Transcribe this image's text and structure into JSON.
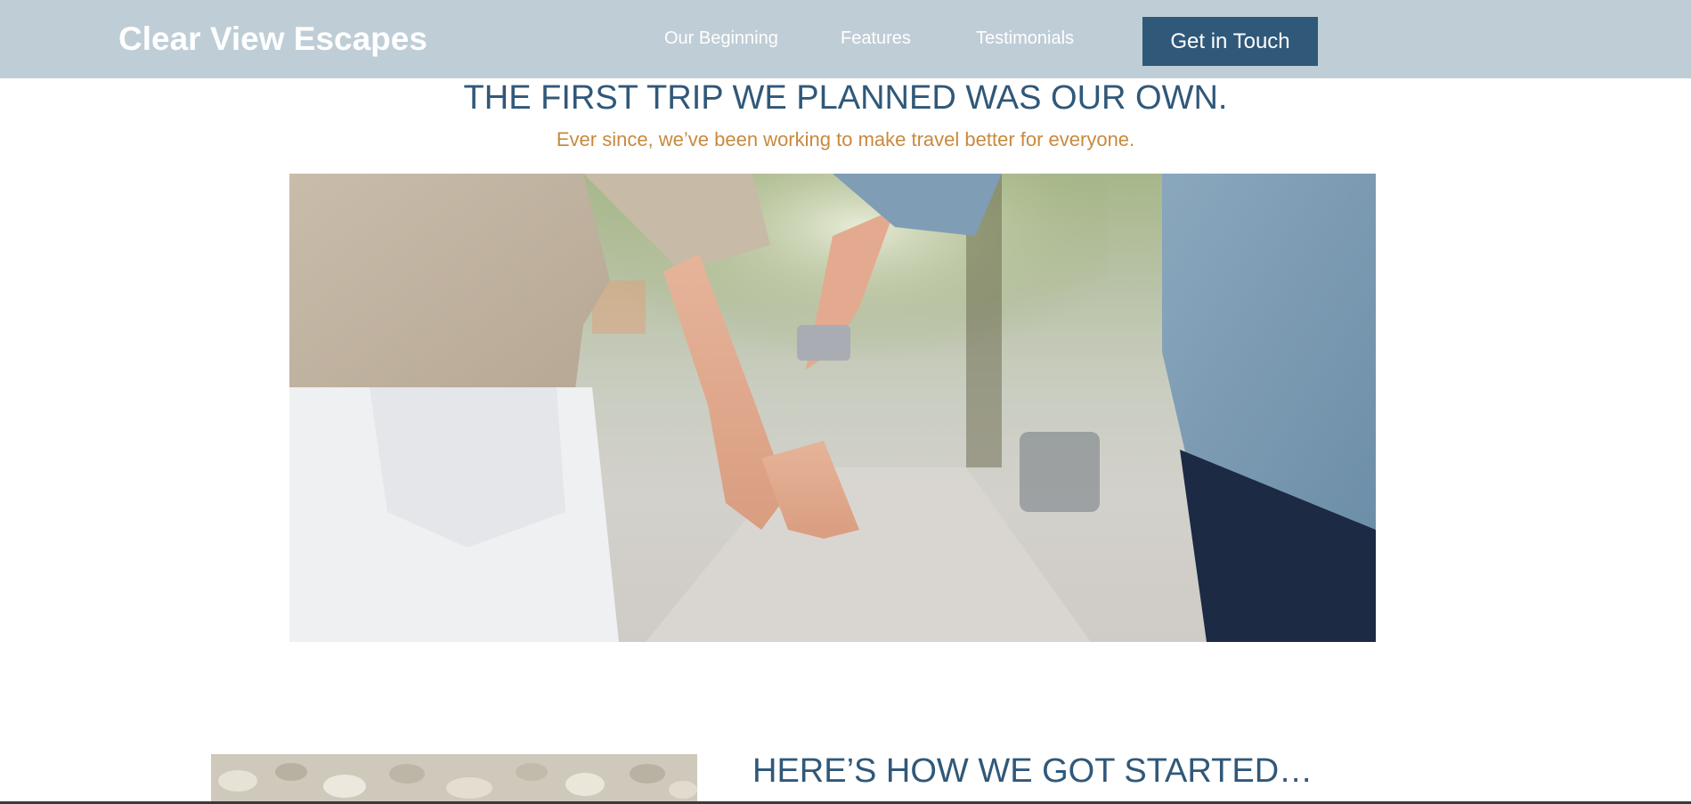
{
  "header": {
    "brand": "Clear View Escapes",
    "nav": [
      {
        "label": "Our Beginning"
      },
      {
        "label": "Features"
      },
      {
        "label": "Testimonials"
      }
    ],
    "cta_label": "Get in Touch"
  },
  "hero": {
    "headline": "THE FIRST TRIP WE PLANNED WAS OUR OWN.",
    "subheadline": "Ever since, we’ve been working to make travel better for everyone."
  },
  "story": {
    "title": "HERE’S HOW WE GOT STARTED…"
  },
  "colors": {
    "header_bg": "#bfcdd6",
    "accent": "#305879",
    "subhead": "#c8893d"
  }
}
